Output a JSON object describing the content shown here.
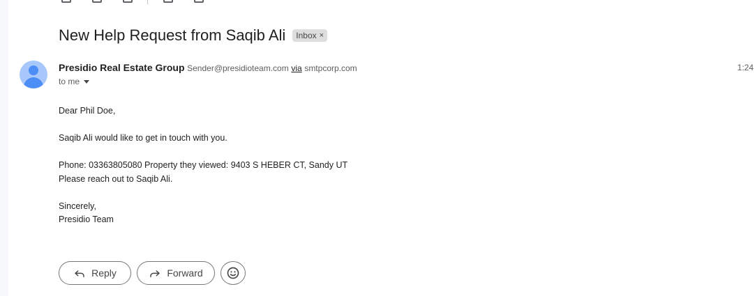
{
  "subject": "New Help Request from Saqib Ali",
  "label": {
    "text": "Inbox",
    "remove_glyph": "×"
  },
  "sender": {
    "name": "Presidio Real Estate Group",
    "email": "Sender@presidioteam.com",
    "via_word": "via",
    "via_domain": "smtpcorp.com"
  },
  "time": "1:24",
  "recipient": "to me",
  "body": {
    "greeting": "Dear Phil Doe,",
    "line1": "Saqib Ali would like to get in touch with you.",
    "line2": "Phone: 03363805080 Property they viewed: 9403 S HEBER CT, Sandy UT",
    "line3": "Please reach out to Saqib Ali.",
    "closing": "Sincerely,",
    "signature": "Presidio Team"
  },
  "actions": {
    "reply_label": "Reply",
    "forward_label": "Forward"
  },
  "icons": {
    "avatar": "person-avatar-icon",
    "reply": "reply-arrow-icon",
    "forward": "forward-arrow-icon",
    "emoji": "smiley-face-icon",
    "details": "chevron-down-icon"
  },
  "colors": {
    "avatar_bg": "#a8c7fa",
    "avatar_fg": "#4c8df6",
    "chip_bg": "#dddddd"
  }
}
